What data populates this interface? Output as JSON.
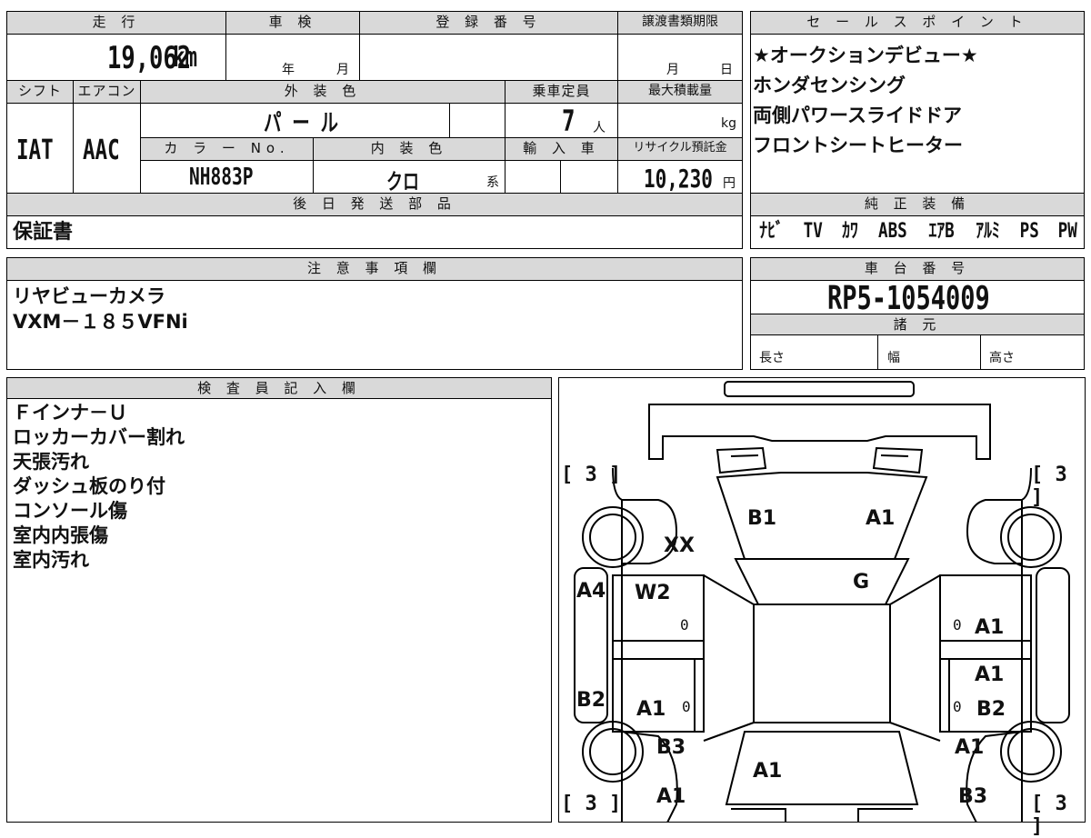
{
  "table": {
    "mileage_label": "走 行",
    "mileage": "19,062",
    "mileage_unit": "km",
    "inspection_label": "車 検",
    "inspection_year": "年",
    "inspection_month": "月",
    "registration_label": "登 録 番 号",
    "transfer_label": "譲渡書類期限",
    "transfer_month": "月",
    "transfer_day": "日",
    "shift_label": "シフト",
    "shift": "IAT",
    "aircon_label": "エアコン",
    "aircon": "AAC",
    "exterior_color_label": "外 装 色",
    "exterior_color": "パ ー ル",
    "capacity_label": "乗車定員",
    "capacity": "7",
    "capacity_unit": "人",
    "max_load_label": "最大積載量",
    "max_load_unit": "kg",
    "color_no_label": "カ ラ ー No.",
    "color_no": "NH883P",
    "interior_color_label": "内 装 色",
    "interior_color": "クロ",
    "interior_suffix": "系",
    "import_label": "輸 入 車",
    "recycle_label": "リサイクル預託金",
    "recycle": "10,230",
    "recycle_unit": "円",
    "shipping_label": "後 日 発 送 部 品",
    "shipping_value": "保証書",
    "notes_label": "注 意 事 項 欄",
    "notes_lines": [
      "リヤビューカメラ",
      "VXM－１８５VFNi"
    ]
  },
  "sales": {
    "label": "セ ー ル ス ポ イ ン ト",
    "lines": [
      "★オークションデビュー★",
      "ホンダセンシング",
      "両側パワースライドドア",
      "フロントシートヒーター"
    ]
  },
  "equipment": {
    "label": "純 正 装 備",
    "items": [
      "ﾅﾋﾞ",
      "TV",
      "ｶﾜ",
      "ABS",
      "ｴｱB",
      "ｱﾙﾐ",
      "PS",
      "PW"
    ]
  },
  "chassis": {
    "label": "車 台 番 号",
    "number": "RP5-1054009"
  },
  "specs": {
    "label": "諸 元",
    "length": "長さ",
    "width": "幅",
    "height": "高さ"
  },
  "inspector": {
    "label": "検 査 員 記 入 欄",
    "lines": [
      "Ｆインナ－Ｕ",
      "ロッカーカバー割れ",
      "天張汚れ",
      "ダッシュ板のり付",
      "コンソール傷",
      "室内内張傷",
      "室内汚れ"
    ]
  },
  "diagram": {
    "tire_tl": "[ 3 ]",
    "tire_tr": "[ 3 ]",
    "tire_bl": "[ 3 ]",
    "tire_br": "[ 3 ]",
    "hood_left": "B1",
    "hood_right": "A1",
    "fender_left": "XX",
    "windshield": "G",
    "pillar_left": "A4",
    "front_door_left": "W2",
    "front_door_left_paint": "0",
    "front_door_right": "A1",
    "front_door_right_paint": "0",
    "rocker_left": "B2",
    "rear_door_left": "A1",
    "rear_door_left_paint": "0",
    "rear_door_right_top": "A1",
    "rear_door_right": "B2",
    "rear_door_right_paint": "0",
    "quarter_left": "B3",
    "quarter_right": "A1",
    "roof_rear": "A1",
    "bumper_left": "A1",
    "bumper_right": "B3"
  }
}
